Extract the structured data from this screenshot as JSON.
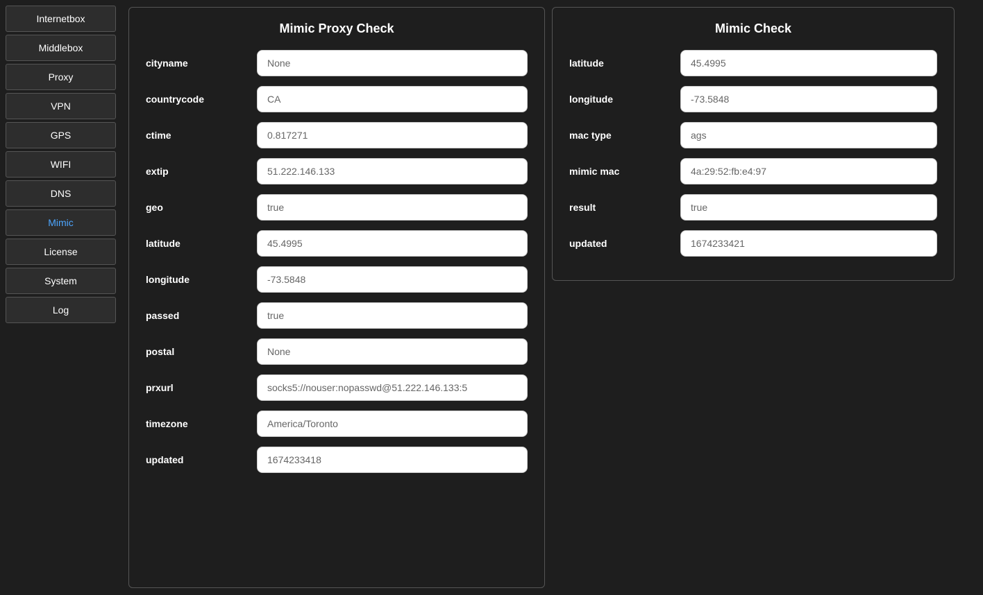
{
  "sidebar": {
    "items": [
      {
        "label": "Internetbox",
        "active": false
      },
      {
        "label": "Middlebox",
        "active": false
      },
      {
        "label": "Proxy",
        "active": false
      },
      {
        "label": "VPN",
        "active": false
      },
      {
        "label": "GPS",
        "active": false
      },
      {
        "label": "WIFI",
        "active": false
      },
      {
        "label": "DNS",
        "active": false
      },
      {
        "label": "Mimic",
        "active": true
      },
      {
        "label": "License",
        "active": false
      },
      {
        "label": "System",
        "active": false
      },
      {
        "label": "Log",
        "active": false
      }
    ]
  },
  "proxy_check": {
    "title": "Mimic Proxy Check",
    "fields": [
      {
        "label": "cityname",
        "value": "None"
      },
      {
        "label": "countrycode",
        "value": "CA"
      },
      {
        "label": "ctime",
        "value": "0.817271"
      },
      {
        "label": "extip",
        "value": "51.222.146.133"
      },
      {
        "label": "geo",
        "value": "true"
      },
      {
        "label": "latitude",
        "value": "45.4995"
      },
      {
        "label": "longitude",
        "value": "-73.5848"
      },
      {
        "label": "passed",
        "value": "true"
      },
      {
        "label": "postal",
        "value": "None"
      },
      {
        "label": "prxurl",
        "value": "socks5://nouser:nopasswd@51.222.146.133:5"
      },
      {
        "label": "timezone",
        "value": "America/Toronto"
      },
      {
        "label": "updated",
        "value": "1674233418"
      }
    ]
  },
  "mimic_check": {
    "title": "Mimic Check",
    "fields": [
      {
        "label": "latitude",
        "value": "45.4995"
      },
      {
        "label": "longitude",
        "value": "-73.5848"
      },
      {
        "label": "mac type",
        "value": "ags"
      },
      {
        "label": "mimic mac",
        "value": "4a:29:52:fb:e4:97"
      },
      {
        "label": "result",
        "value": "true"
      },
      {
        "label": "updated",
        "value": "1674233421"
      }
    ]
  }
}
